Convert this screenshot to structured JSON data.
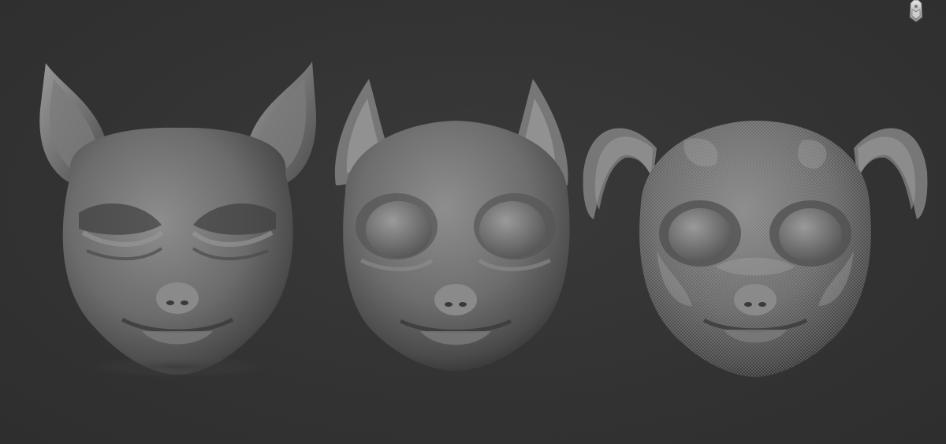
{
  "viewport": {
    "background": "#333333",
    "models": [
      {
        "name": "cat-head-closed-eyes",
        "variant": "pointed ears, closed eyes"
      },
      {
        "name": "cat-head-open-eyes",
        "variant": "slim ears, open eyes"
      },
      {
        "name": "puppy-head-floppy-ears",
        "variant": "folded ears, open eyes, wireframe polypaint"
      }
    ],
    "gizmo_icon": "orientation-gizmo-icon"
  }
}
